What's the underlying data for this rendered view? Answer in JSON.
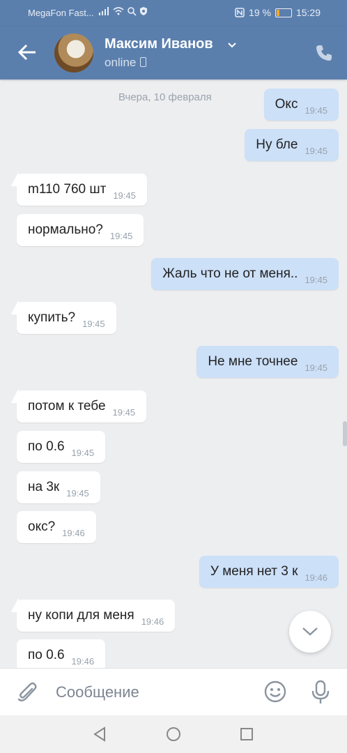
{
  "status": {
    "carrier": "MegaFon Fast...",
    "battery": "19 %",
    "battery_level": 0.19,
    "time": "15:29"
  },
  "header": {
    "name": "Максим Иванов",
    "status": "online"
  },
  "date_separator": "Вчера, 10 февраля",
  "messages": [
    {
      "dir": "out",
      "text": "Окс",
      "time": "19:45"
    },
    {
      "dir": "out",
      "text": "Ну бле",
      "time": "19:45"
    },
    {
      "dir": "in",
      "text": "m110 760 шт",
      "time": "19:45"
    },
    {
      "dir": "in",
      "text": "нормально?",
      "time": "19:45"
    },
    {
      "dir": "out",
      "text": "Жаль что не от меня..",
      "time": "19:45"
    },
    {
      "dir": "in",
      "text": "купить?",
      "time": "19:45"
    },
    {
      "dir": "out",
      "text": "Не мне точнее",
      "time": "19:45"
    },
    {
      "dir": "in",
      "text": "потом к тебе",
      "time": "19:45"
    },
    {
      "dir": "in",
      "text": "по 0.6",
      "time": "19:45"
    },
    {
      "dir": "in",
      "text": "на 3к",
      "time": "19:45"
    },
    {
      "dir": "in",
      "text": "окс?",
      "time": "19:46"
    },
    {
      "dir": "out",
      "text": "У меня нет 3 к",
      "time": "19:46"
    },
    {
      "dir": "in",
      "text": "ну копи для меня",
      "time": "19:46"
    },
    {
      "dir": "in",
      "text": "по 0.6",
      "time": "19:46"
    }
  ],
  "composer": {
    "placeholder": "Сообщение"
  },
  "colors": {
    "header": "#5b7fad",
    "outgoing": "#cce0f8",
    "incoming": "#ffffff",
    "background": "#edeef0"
  }
}
